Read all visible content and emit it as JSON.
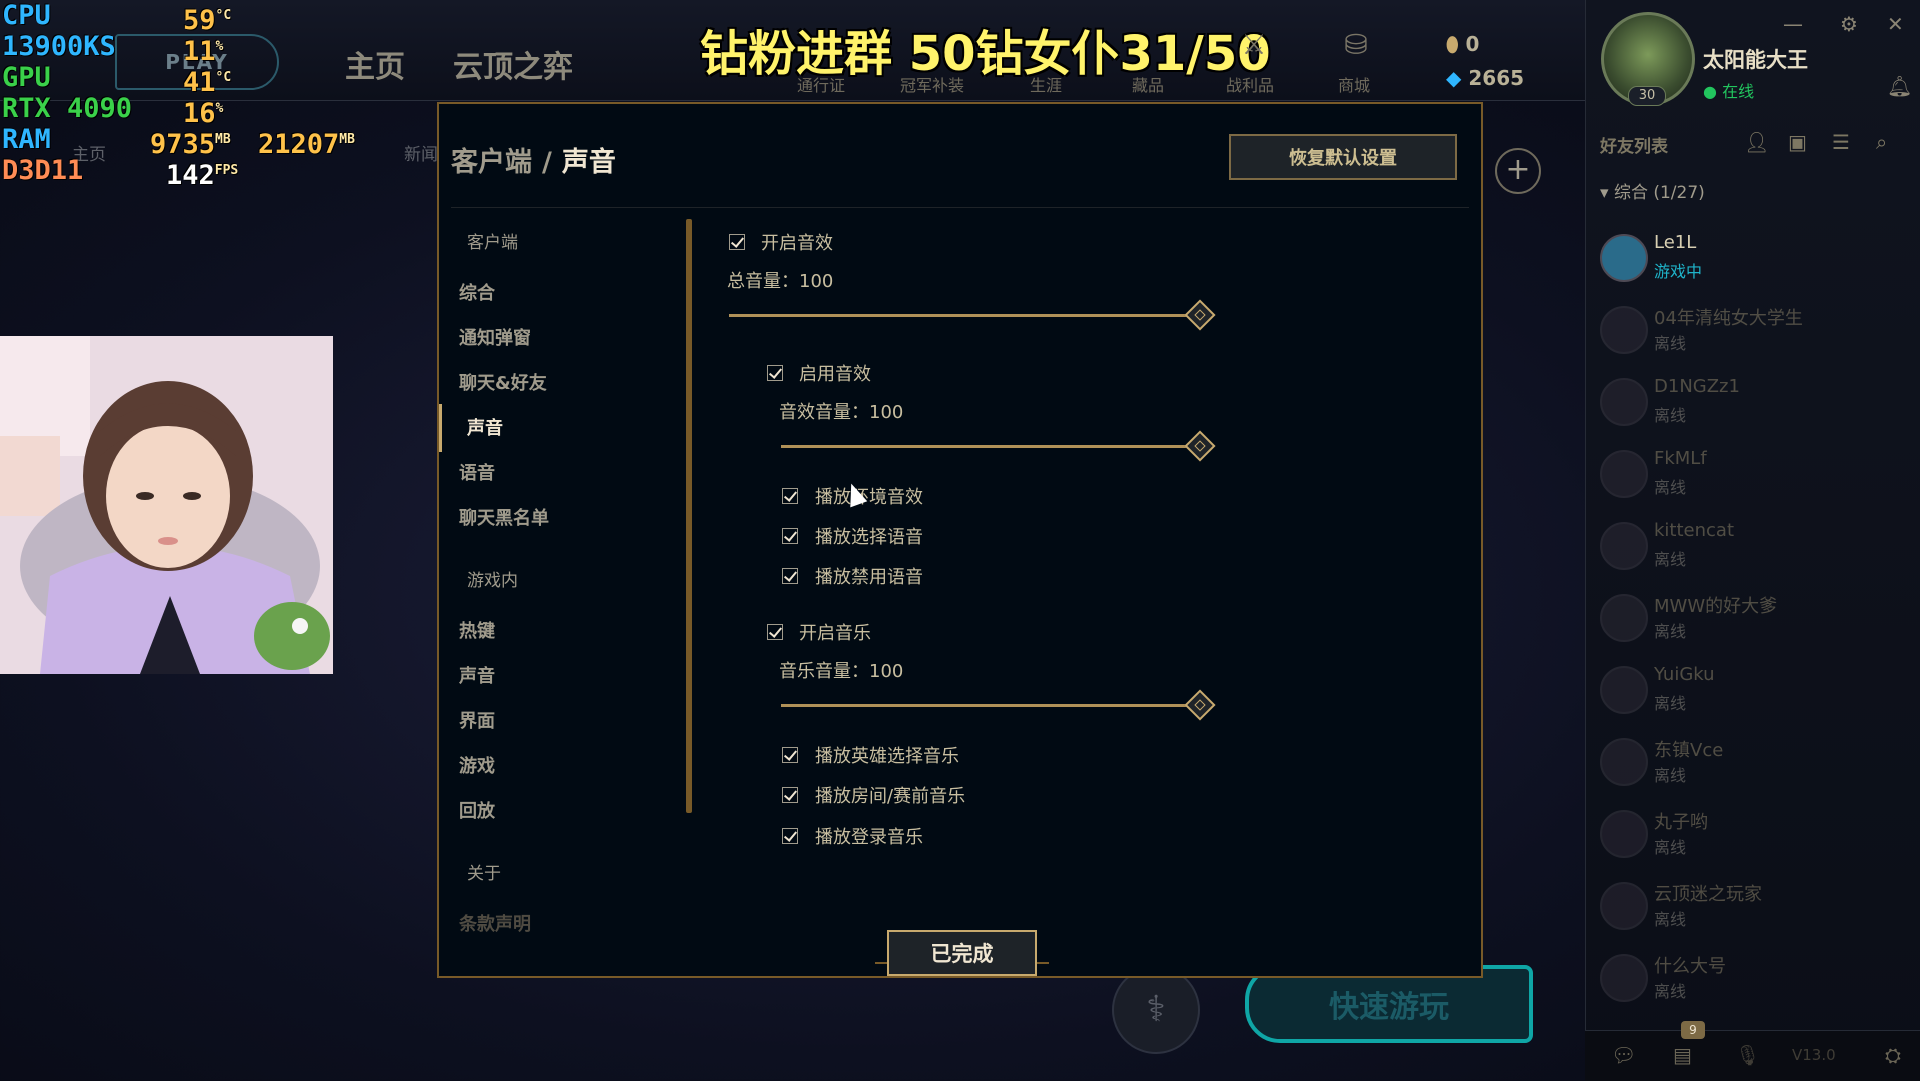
{
  "hud": {
    "cpu_label": "CPU",
    "cpu_temp": "59",
    "cpu_temp_unit": "°C",
    "cpu_model": "13900KS",
    "cpu_load": "11",
    "cpu_load_unit": "%",
    "gpu_label": "GPU",
    "gpu_temp": "41",
    "gpu_temp_unit": "°C",
    "gpu_model": "RTX 4090",
    "gpu_load": "16",
    "gpu_load_unit": "%",
    "ram_label": "RAM",
    "ram_used": "9735",
    "ram_used_unit": "MB",
    "ram_total": "21207",
    "ram_total_unit": "MB",
    "api_label": "D3D11",
    "fps": "142",
    "fps_unit": "FPS"
  },
  "topbar": {
    "play": "PLAY",
    "nav": [
      "主页",
      "云顶之弈"
    ],
    "sub_nav": [
      "主页",
      "新闻"
    ],
    "banner": "钻粉进群 50钻女仆31/50",
    "tabs": [
      "通行证",
      "冠军补装",
      "生涯",
      "藏品",
      "战利品",
      "商城"
    ],
    "currency_rp": "0",
    "currency_be": "2665"
  },
  "profile": {
    "name": "太阳能大王",
    "status": "在线",
    "level": "30"
  },
  "social": {
    "title": "好友列表",
    "group": "综合 (1/27)",
    "friends": [
      {
        "name": "Le1L",
        "status": "游戏中"
      },
      {
        "name": "04年清纯女大学生",
        "status": "离线"
      },
      {
        "name": "D1NGZz1",
        "status": "离线"
      },
      {
        "name": "FkMLf",
        "status": "离线"
      },
      {
        "name": "kittencat",
        "status": "离线"
      },
      {
        "name": "MWW的好大爹",
        "status": "离线"
      },
      {
        "name": "YuiGku",
        "status": "离线"
      },
      {
        "name": "东镇Vce",
        "status": "离线"
      },
      {
        "name": "丸子哟",
        "status": "离线"
      },
      {
        "name": "云顶迷之玩家",
        "status": "离线"
      },
      {
        "name": "什么大号",
        "status": "离线"
      }
    ],
    "chat_badge": "9",
    "version": "V13.0"
  },
  "modal": {
    "breadcrumb_parent": "客户端",
    "breadcrumb_sep": "/",
    "breadcrumb_current": "声音",
    "reset_label": "恢复默认设置",
    "done_label": "已完成",
    "nav": {
      "section_client": "客户端",
      "client_items": [
        "综合",
        "通知弹窗",
        "聊天&好友",
        "声音",
        "语音",
        "聊天黑名单"
      ],
      "section_ingame": "游戏内",
      "ingame_items": [
        "热键",
        "声音",
        "界面",
        "游戏",
        "回放"
      ],
      "section_about": "关于",
      "about_items": [
        "条款声明"
      ]
    },
    "sound": {
      "enable_sound": "开启音效",
      "master_volume_label": "总音量：100",
      "master_volume": 100,
      "enable_sfx": "启用音效",
      "sfx_volume_label": "音效音量：100",
      "sfx_volume": 100,
      "sfx_options": [
        "播放环境音效",
        "播放选择语音",
        "播放禁用语音"
      ],
      "enable_music": "开启音乐",
      "music_volume_label": "音乐音量：100",
      "music_volume": 100,
      "music_options": [
        "播放英雄选择音乐",
        "播放房间/赛前音乐",
        "播放登录音乐"
      ]
    }
  },
  "bottom": {
    "quick_play": "快速游玩"
  }
}
